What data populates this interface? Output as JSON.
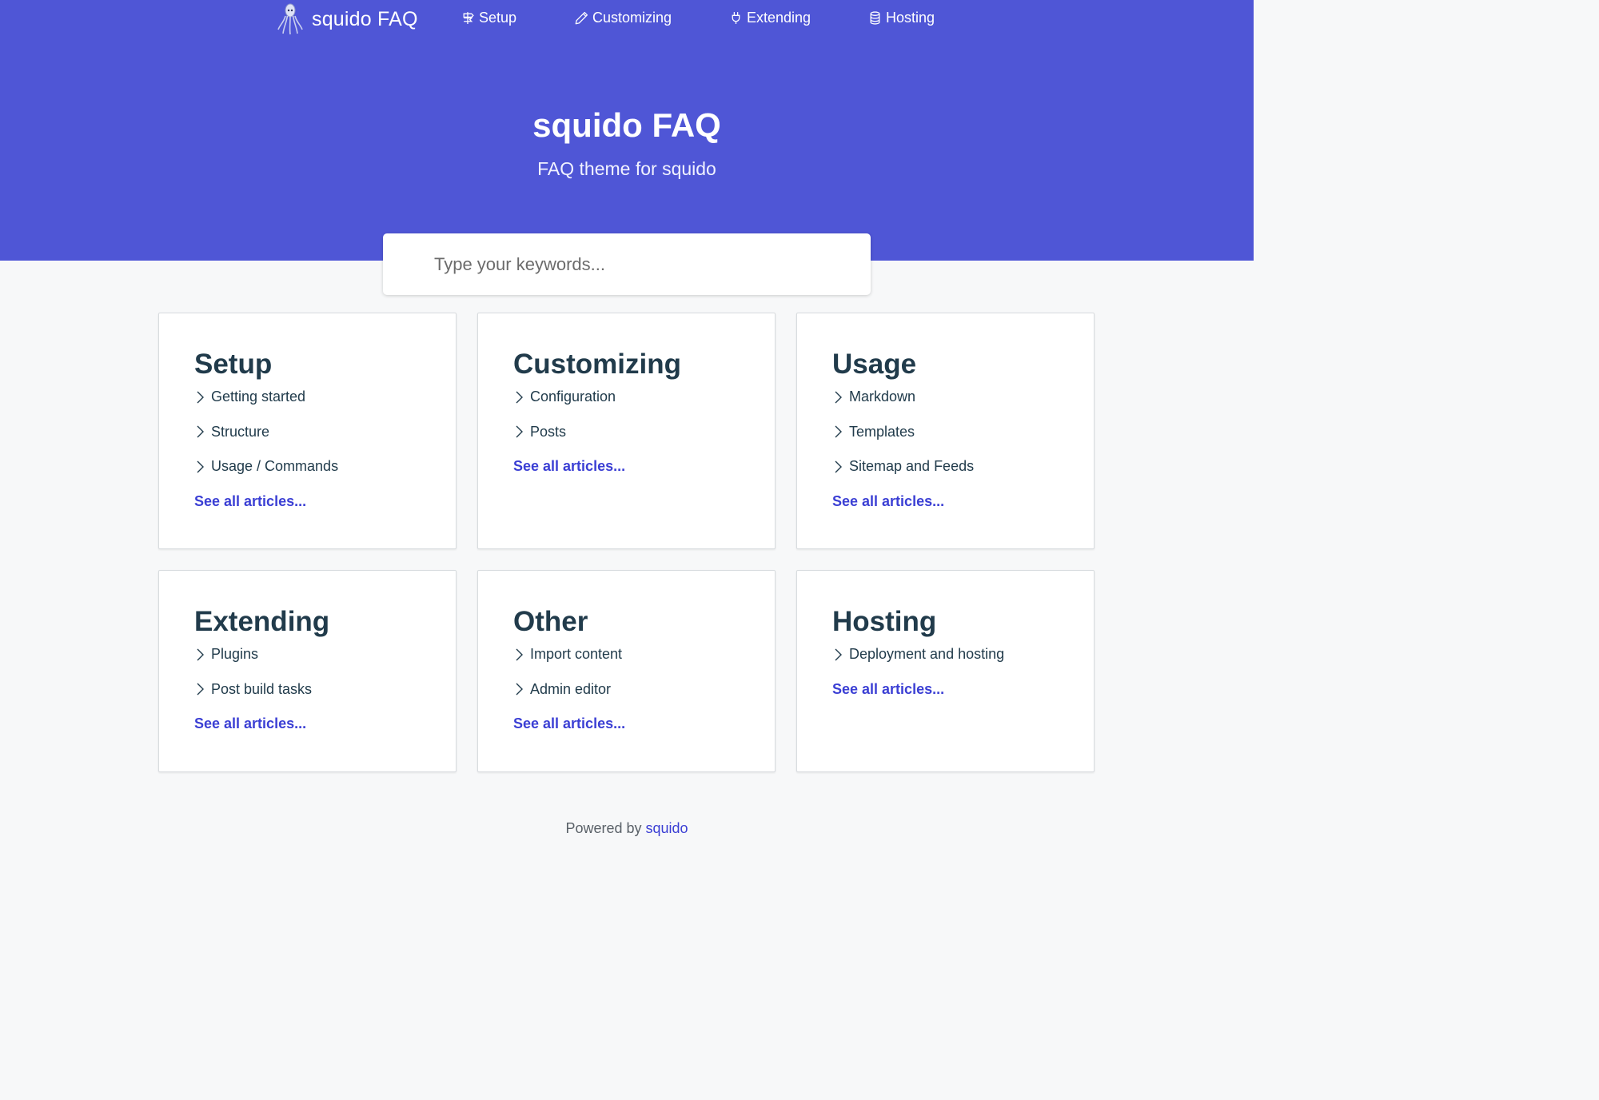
{
  "nav": {
    "brand": "squido FAQ",
    "links": [
      {
        "label": "Setup",
        "icon": "signpost-icon"
      },
      {
        "label": "Customizing",
        "icon": "pencil-icon"
      },
      {
        "label": "Extending",
        "icon": "plug-icon"
      },
      {
        "label": "Hosting",
        "icon": "database-icon"
      }
    ]
  },
  "hero": {
    "title": "squido FAQ",
    "subtitle": "FAQ theme for squido"
  },
  "search": {
    "placeholder": "Type your keywords..."
  },
  "cards": [
    {
      "title": "Setup",
      "items": [
        "Getting started",
        "Structure",
        "Usage / Commands"
      ],
      "see_all": "See all articles..."
    },
    {
      "title": "Customizing",
      "items": [
        "Configuration",
        "Posts"
      ],
      "see_all": "See all articles..."
    },
    {
      "title": "Usage",
      "items": [
        "Markdown",
        "Templates",
        "Sitemap and Feeds"
      ],
      "see_all": "See all articles..."
    },
    {
      "title": "Extending",
      "items": [
        "Plugins",
        "Post build tasks"
      ],
      "see_all": "See all articles..."
    },
    {
      "title": "Other",
      "items": [
        "Import content",
        "Admin editor"
      ],
      "see_all": "See all articles..."
    },
    {
      "title": "Hosting",
      "items": [
        "Deployment and hosting"
      ],
      "see_all": "See all articles..."
    }
  ],
  "footer": {
    "prefix": "Powered by",
    "link": "squido"
  },
  "colors": {
    "hero_bg": "#4f56d6",
    "accent_link": "#3b3fd4",
    "heading": "#213b4b",
    "page_bg": "#f7f8f9"
  }
}
